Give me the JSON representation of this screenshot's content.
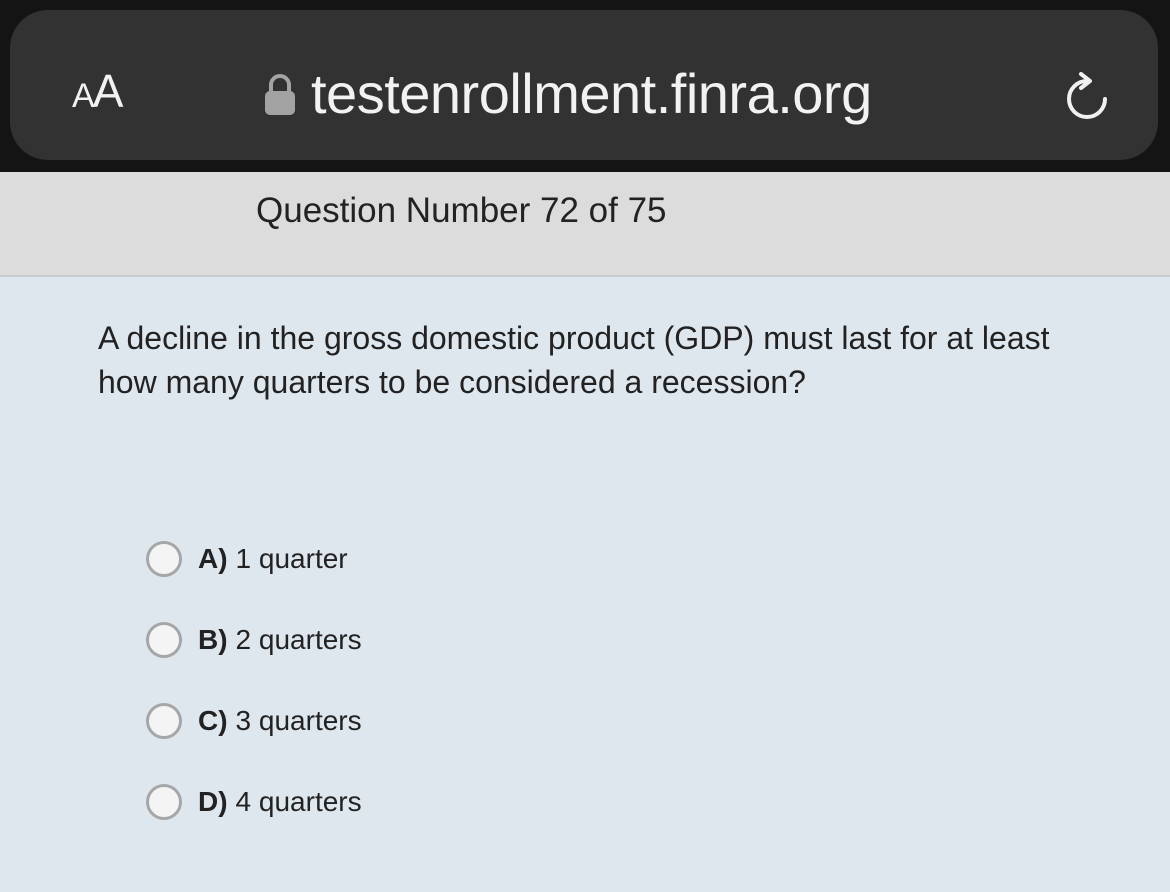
{
  "browser": {
    "text_size_button": {
      "large": "A",
      "small": "A"
    },
    "url": "testenrollment.finra.org",
    "icons": {
      "lock": "lock-icon",
      "reload": "reload-icon"
    }
  },
  "exam": {
    "question_number": "Question Number 72 of 75",
    "question_text": "A decline in the gross domestic product (GDP) must last for at least how many quarters to be considered a recession?",
    "options": [
      {
        "letter": "A)",
        "text": "1 quarter"
      },
      {
        "letter": "B)",
        "text": "2 quarters"
      },
      {
        "letter": "C)",
        "text": "3 quarters"
      },
      {
        "letter": "D)",
        "text": "4 quarters"
      }
    ]
  },
  "colors": {
    "chrome_bg": "#141414",
    "address_bar_bg": "#323232",
    "header_bg": "#dcdcdc",
    "content_bg": "#dfe7ee"
  }
}
